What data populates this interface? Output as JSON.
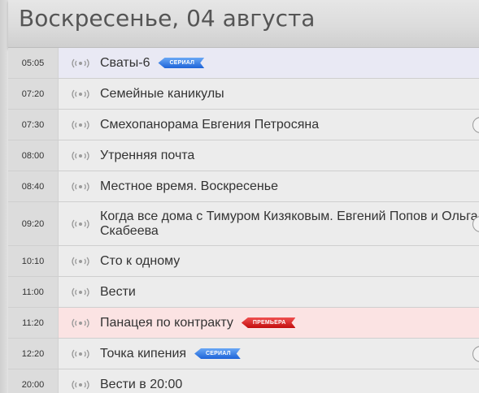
{
  "header": {
    "title": "Воскресенье, 04 августа"
  },
  "schedule": [
    {
      "time": "05:05",
      "title": "Сваты-6",
      "badge": "СЕРИАЛ",
      "badge_type": "serial",
      "highlight": "serial",
      "more": false
    },
    {
      "time": "07:20",
      "title": "Семейные каникулы",
      "badge": "",
      "badge_type": "",
      "highlight": "",
      "more": false
    },
    {
      "time": "07:30",
      "title": "Смехопанорама Евгения Петросяна",
      "badge": "",
      "badge_type": "",
      "highlight": "",
      "more": true
    },
    {
      "time": "08:00",
      "title": "Утренняя почта",
      "badge": "",
      "badge_type": "",
      "highlight": "",
      "more": false
    },
    {
      "time": "08:40",
      "title": "Местное время. Воскресенье",
      "badge": "",
      "badge_type": "",
      "highlight": "",
      "more": false
    },
    {
      "time": "09:20",
      "title": "Когда все дома с Тимуром Кизяковым. Евгений Попов и Ольга Скабеева",
      "badge": "",
      "badge_type": "",
      "highlight": "",
      "more": true,
      "multiline": true
    },
    {
      "time": "10:10",
      "title": "Сто к одному",
      "badge": "",
      "badge_type": "",
      "highlight": "",
      "more": false
    },
    {
      "time": "11:00",
      "title": "Вести",
      "badge": "",
      "badge_type": "",
      "highlight": "",
      "more": false
    },
    {
      "time": "11:20",
      "title": "Панацея по контракту",
      "badge": "ПРЕМЬЕРА",
      "badge_type": "premiere",
      "highlight": "premiere",
      "more": false
    },
    {
      "time": "12:20",
      "title": "Точка кипения",
      "badge": "СЕРИАЛ",
      "badge_type": "serial",
      "highlight": "",
      "more": true
    },
    {
      "time": "20:00",
      "title": "Вести в 20:00",
      "badge": "",
      "badge_type": "",
      "highlight": "",
      "more": false
    }
  ],
  "icons": {
    "broadcast": "broadcast-icon",
    "more": "chevron-right-icon"
  },
  "colors": {
    "serial_badge": "#2a6fe0",
    "premiere_badge": "#d01818",
    "serial_row": "#e9e9f4",
    "premiere_row": "#fbe3e3"
  }
}
